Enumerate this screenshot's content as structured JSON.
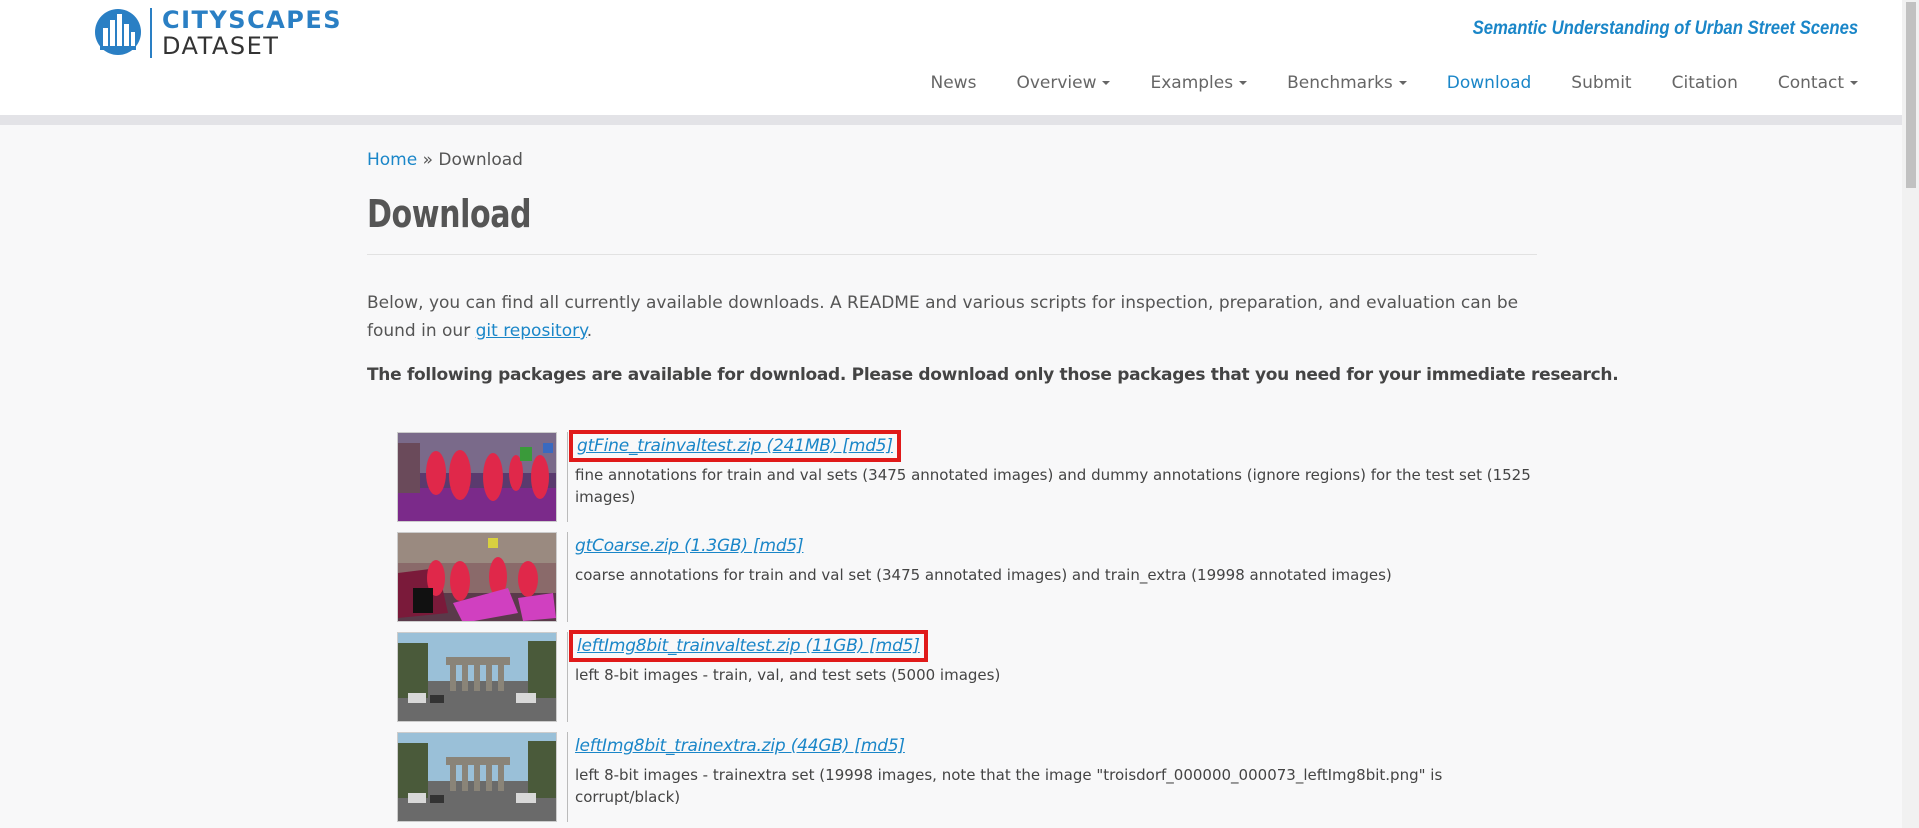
{
  "logo": {
    "line1": "CITYSCAPES",
    "line2": "DATASET",
    "icon": "city-skyline-logo-icon",
    "accent": "#2a7fc4"
  },
  "tagline": "Semantic Understanding of Urban Street Scenes",
  "nav": {
    "items": [
      {
        "label": "News",
        "dropdown": false,
        "active": false
      },
      {
        "label": "Overview",
        "dropdown": true,
        "active": false
      },
      {
        "label": "Examples",
        "dropdown": true,
        "active": false
      },
      {
        "label": "Benchmarks",
        "dropdown": true,
        "active": false
      },
      {
        "label": "Download",
        "dropdown": false,
        "active": true
      },
      {
        "label": "Submit",
        "dropdown": false,
        "active": false
      },
      {
        "label": "Citation",
        "dropdown": false,
        "active": false
      },
      {
        "label": "Contact",
        "dropdown": true,
        "active": false
      }
    ],
    "active_color": "#1a86c8"
  },
  "breadcrumb": {
    "home": "Home",
    "separator": " » ",
    "current": "Download"
  },
  "page_title": "Download",
  "intro": {
    "text_before": "Below, you can find all currently available downloads. A README and various scripts for inspection, preparation, and evaluation can be found in our ",
    "link": "git repository",
    "text_after": "."
  },
  "lead": "The following packages are available for download. Please download only those packages that you need for your immediate research.",
  "downloads": [
    {
      "link": "gtFine_trainvaltest.zip (241MB) [md5]",
      "desc": "fine annotations for train and val sets (3475 annotated images) and dummy annotations (ignore regions) for the test set (1525 images)",
      "highlighted": true,
      "thumb": "fine-annotation-thumbnail"
    },
    {
      "link": "gtCoarse.zip (1.3GB) [md5]",
      "desc": "coarse annotations for train and val set (3475 annotated images) and train_extra (19998 annotated images)",
      "highlighted": false,
      "thumb": "coarse-annotation-thumbnail"
    },
    {
      "link": "leftImg8bit_trainvaltest.zip (11GB) [md5]",
      "desc": "left 8-bit images - train, val, and test sets (5000 images)",
      "highlighted": true,
      "thumb": "street-photo-thumbnail"
    },
    {
      "link": "leftImg8bit_trainextra.zip (44GB) [md5]",
      "desc": "left 8-bit images - trainextra set (19998 images, note that the image \"troisdorf_000000_000073_leftImg8bit.png\" is corrupt/black)",
      "highlighted": false,
      "thumb": "street-photo-thumbnail"
    }
  ],
  "highlight_color": "#e01a1a"
}
